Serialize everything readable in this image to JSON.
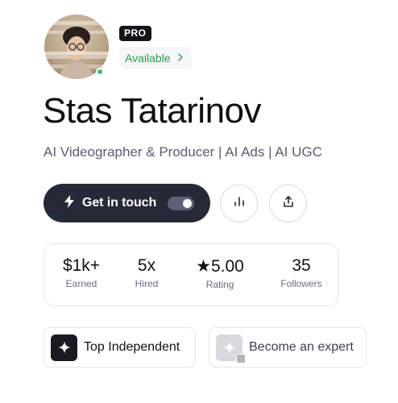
{
  "profile": {
    "name": "Stas Tatarinov",
    "subtitle": "AI Videographer & Producer | AI Ads | AI UGC",
    "pro_badge": "PRO",
    "availability": "Available"
  },
  "actions": {
    "get_in_touch_label": "Get in touch",
    "toggle_on": true
  },
  "stats": [
    {
      "value": "$1k+",
      "label": "Earned"
    },
    {
      "value": "5x",
      "label": "Hired"
    },
    {
      "value": "★5.00",
      "label": "Rating"
    },
    {
      "value": "35",
      "label": "Followers"
    }
  ],
  "cards": {
    "top_independent": "Top Independent",
    "become_expert": "Become an expert"
  },
  "colors": {
    "primary_button": "#262a38",
    "available_green": "#2f9a4e",
    "online_dot": "#3ec46d"
  },
  "icons": [
    "bolt-icon",
    "chevron-right-icon",
    "bar-chart-icon",
    "share-icon",
    "sparkle-icon",
    "lock-icon"
  ]
}
